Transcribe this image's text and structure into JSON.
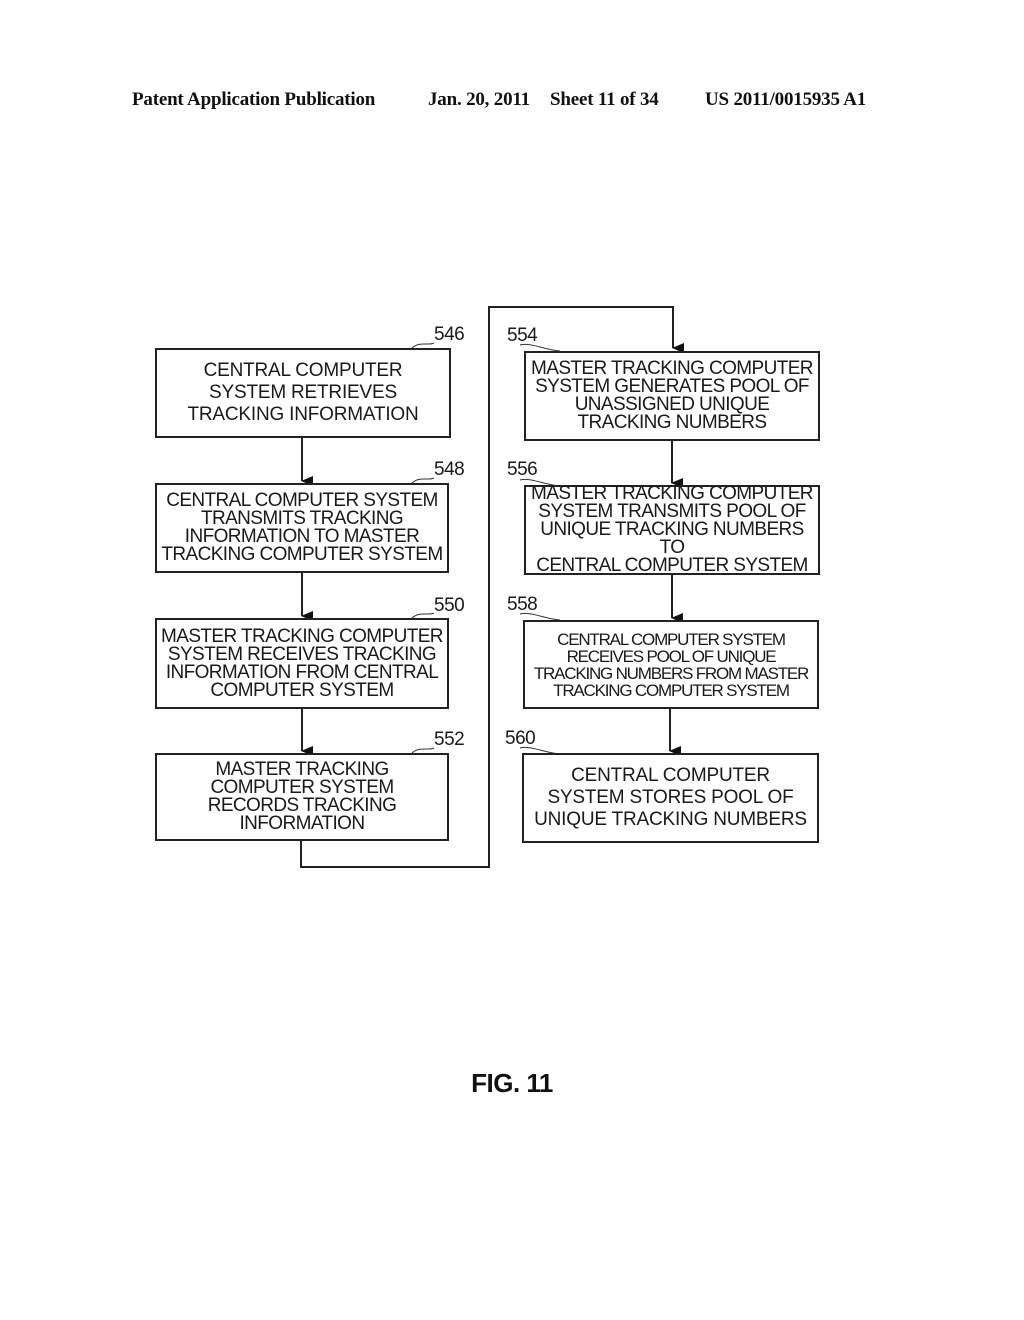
{
  "header": {
    "publication": "Patent Application Publication",
    "date": "Jan. 20, 2011",
    "sheet": "Sheet 11 of 34",
    "number": "US 2011/0015935 A1"
  },
  "flowchart": {
    "left_column": [
      {
        "ref": "546",
        "text": "CENTRAL COMPUTER\nSYSTEM RETRIEVES\nTRACKING INFORMATION"
      },
      {
        "ref": "548",
        "text": "CENTRAL COMPUTER SYSTEM\nTRANSMITS TRACKING\nINFORMATION TO MASTER\nTRACKING COMPUTER SYSTEM"
      },
      {
        "ref": "550",
        "text": "MASTER TRACKING COMPUTER\nSYSTEM RECEIVES TRACKING\nINFORMATION FROM CENTRAL\nCOMPUTER SYSTEM"
      },
      {
        "ref": "552",
        "text": "MASTER TRACKING\nCOMPUTER SYSTEM\nRECORDS TRACKING\nINFORMATION"
      }
    ],
    "right_column": [
      {
        "ref": "554",
        "text": "MASTER TRACKING COMPUTER\nSYSTEM GENERATES POOL OF\nUNASSIGNED UNIQUE\nTRACKING NUMBERS"
      },
      {
        "ref": "556",
        "text": "MASTER TRACKING COMPUTER\nSYSTEM TRANSMITS POOL OF\nUNIQUE TRACKING NUMBERS TO\nCENTRAL COMPUTER SYSTEM"
      },
      {
        "ref": "558",
        "text": "CENTRAL COMPUTER SYSTEM\nRECEIVES POOL OF UNIQUE\nTRACKING NUMBERS FROM MASTER\nTRACKING COMPUTER SYSTEM"
      },
      {
        "ref": "560",
        "text": "CENTRAL COMPUTER\nSYSTEM STORES POOL OF\nUNIQUE TRACKING NUMBERS"
      }
    ]
  },
  "figure_label": "FIG. 11"
}
